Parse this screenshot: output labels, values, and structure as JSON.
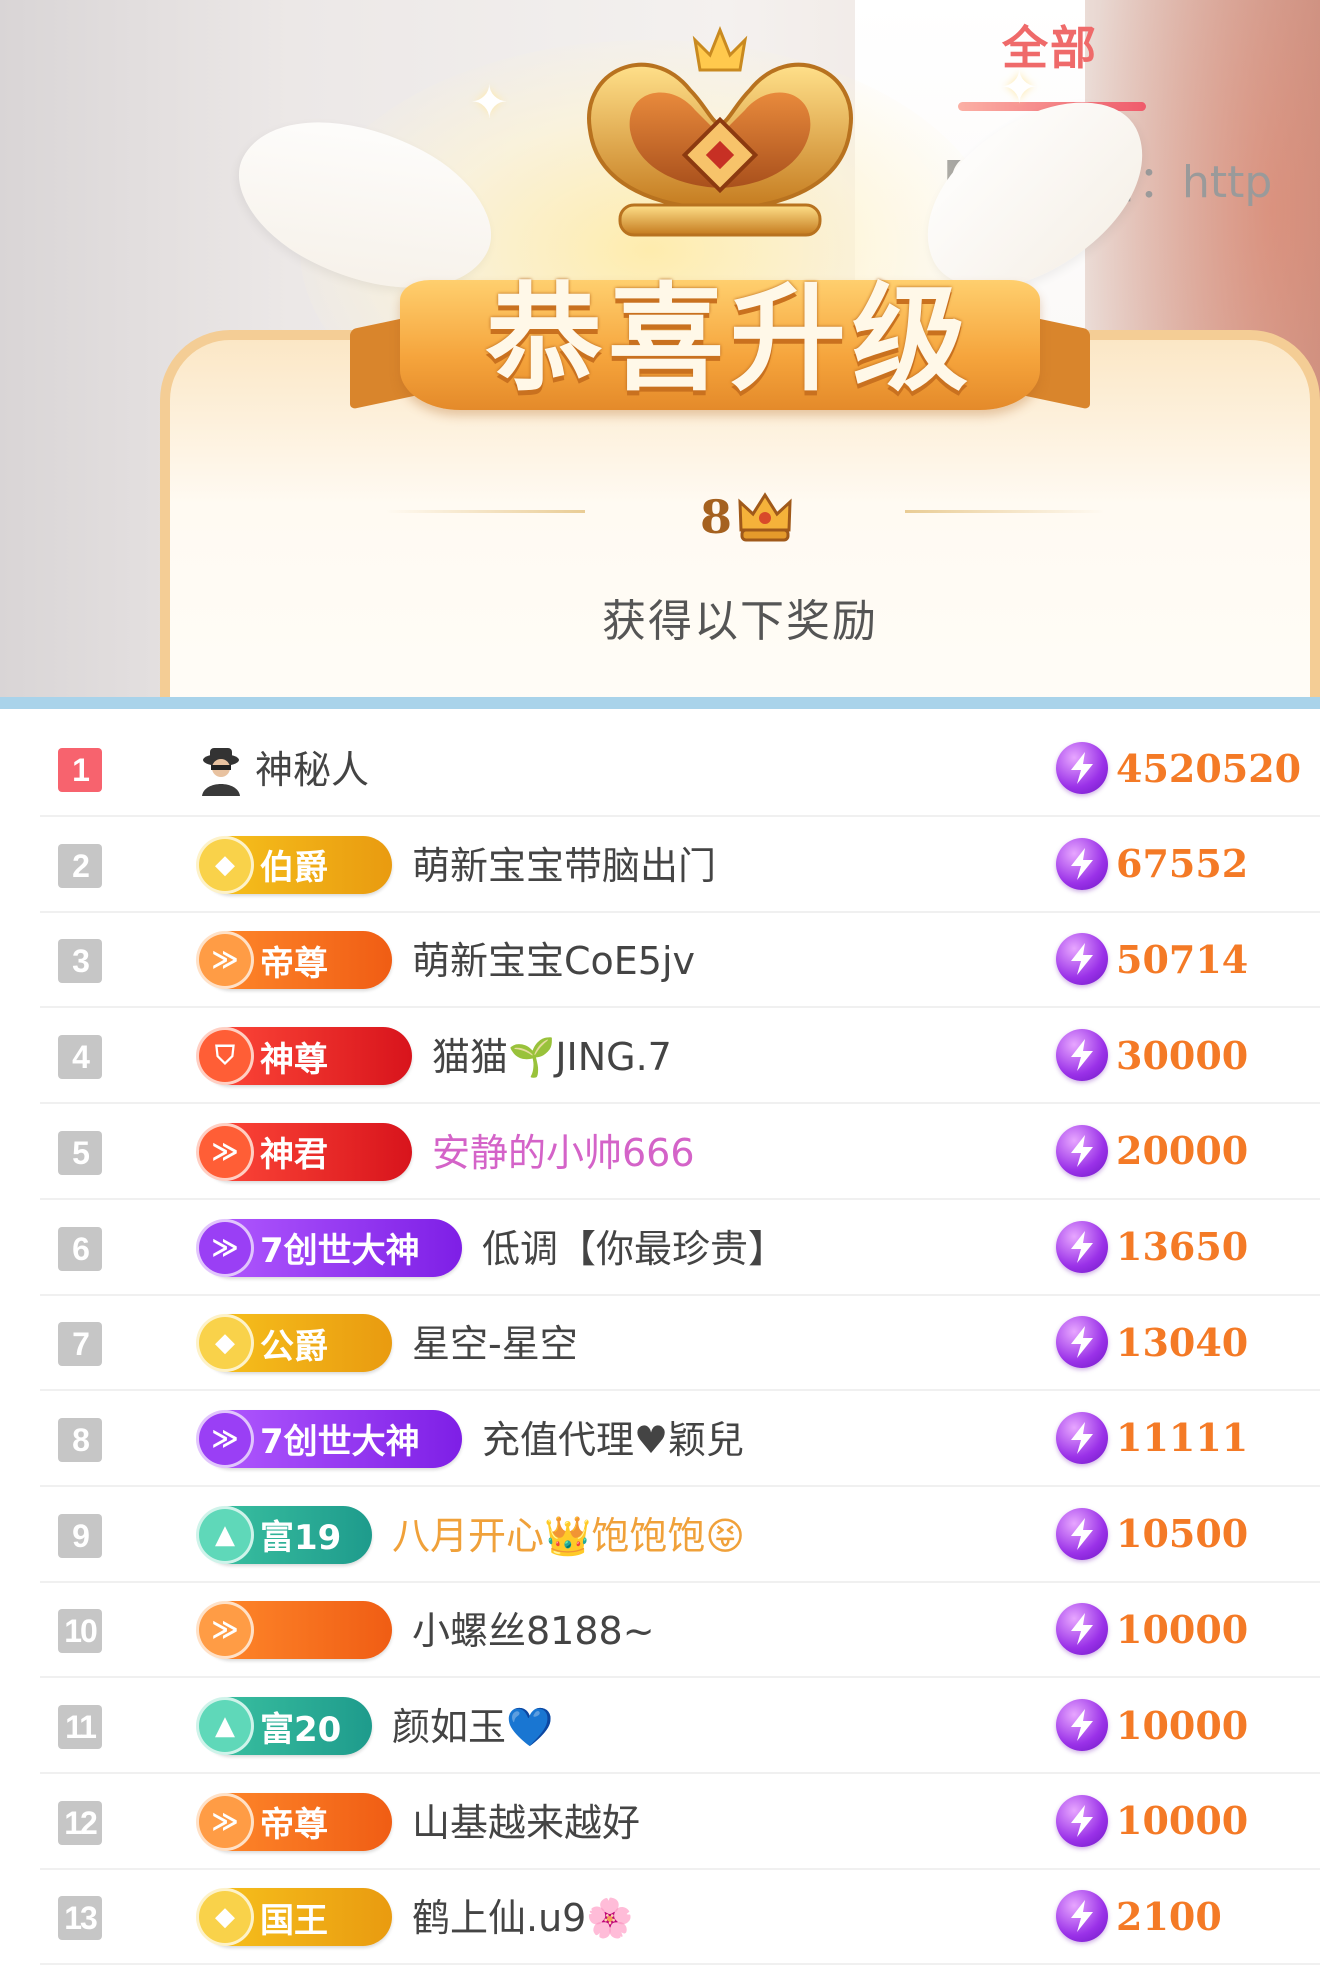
{
  "popup": {
    "title": "恭喜升级",
    "level": "8",
    "level_icon": "crown-icon",
    "subtitle": "获得以下奖励"
  },
  "tabs": {
    "active": "全部"
  },
  "room_notice": "【房间公告：http",
  "colors": {
    "top1": "#f7636e",
    "rank": "#c6c6c6",
    "score": "#f47a26",
    "divider": "#a9d3ea",
    "tab": "#ef6a6a"
  },
  "score_icon": "lightning-coin-icon",
  "rows": [
    {
      "rank": "1",
      "badge": "",
      "badge_style": "none",
      "badge_icon": "",
      "name": "神秘人",
      "name_color": "#444444",
      "avatar_icon": "mystery-person-icon",
      "score": "4520520"
    },
    {
      "rank": "2",
      "badge": "伯爵",
      "badge_style": "gold",
      "badge_icon": "gem-icon",
      "name": "萌新宝宝带脑出门",
      "name_color": "#444444",
      "score": "67552"
    },
    {
      "rank": "3",
      "badge": "帝尊",
      "badge_style": "orange",
      "badge_icon": "chevron-icon",
      "name": "萌新宝宝CoE5jv",
      "name_color": "#444444",
      "score": "50714"
    },
    {
      "rank": "4",
      "badge": "神尊",
      "badge_style": "red",
      "badge_icon": "shield-icon",
      "name": "猫猫🌱JING.7",
      "name_color": "#444444",
      "score": "30000"
    },
    {
      "rank": "5",
      "badge": "神君",
      "badge_style": "red",
      "badge_icon": "chevron-icon",
      "name": "安静的小帅666",
      "name_color": "#d463c8",
      "score": "20000"
    },
    {
      "rank": "6",
      "badge": "7创世大神",
      "badge_style": "purple",
      "badge_icon": "chevron-icon",
      "name": "低调【你最珍贵】",
      "name_color": "#444444",
      "score": "13650"
    },
    {
      "rank": "7",
      "badge": "公爵",
      "badge_style": "gold",
      "badge_icon": "gem-icon",
      "name": "星空-星空",
      "name_color": "#444444",
      "score": "13040"
    },
    {
      "rank": "8",
      "badge": "7创世大神",
      "badge_style": "purple",
      "badge_icon": "chevron-icon",
      "name": "充值代理♥颖兒",
      "name_color": "#444444",
      "score": "11111"
    },
    {
      "rank": "9",
      "badge": "富19",
      "badge_style": "teal",
      "badge_icon": "triangle-icon",
      "name": "八月开心👑饱饱饱😝",
      "name_color": "#f0a13a",
      "score": "10500"
    },
    {
      "rank": "10",
      "badge": "",
      "badge_style": "orange",
      "badge_icon": "chevron-icon",
      "name": "小螺丝8188~",
      "name_color": "#444444",
      "score": "10000"
    },
    {
      "rank": "11",
      "badge": "富20",
      "badge_style": "teal",
      "badge_icon": "triangle-icon",
      "name": "颜如玉💙",
      "name_color": "#444444",
      "score": "10000"
    },
    {
      "rank": "12",
      "badge": "帝尊",
      "badge_style": "orange",
      "badge_icon": "chevron-icon",
      "name": "山基越来越好",
      "name_color": "#444444",
      "score": "10000"
    },
    {
      "rank": "13",
      "badge": "国王",
      "badge_style": "gold",
      "badge_icon": "gem-icon",
      "name": "鹤上仙.u9🌸",
      "name_color": "#444444",
      "score": "2100"
    }
  ]
}
